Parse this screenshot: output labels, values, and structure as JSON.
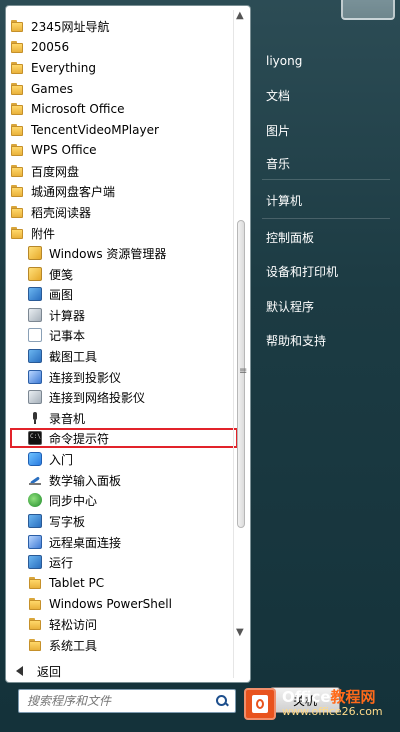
{
  "left_menu": {
    "items": [
      {
        "label": "2345网址导航",
        "icon": "folder-icon"
      },
      {
        "label": "20056",
        "icon": "folder-icon"
      },
      {
        "label": "Everything",
        "icon": "folder-icon"
      },
      {
        "label": "Games",
        "icon": "folder-icon"
      },
      {
        "label": "Microsoft Office",
        "icon": "folder-icon"
      },
      {
        "label": "TencentVideoMPlayer",
        "icon": "folder-icon"
      },
      {
        "label": "WPS Office",
        "icon": "folder-icon"
      },
      {
        "label": "百度网盘",
        "icon": "folder-icon"
      },
      {
        "label": "城通网盘客户端",
        "icon": "folder-icon"
      },
      {
        "label": "稻壳阅读器",
        "icon": "folder-icon"
      },
      {
        "label": "附件",
        "icon": "folder-icon"
      }
    ],
    "accessories": [
      {
        "label": "Windows 资源管理器",
        "icon": "explorer-icon"
      },
      {
        "label": "便笺",
        "icon": "sticky-notes-icon"
      },
      {
        "label": "画图",
        "icon": "paint-icon"
      },
      {
        "label": "计算器",
        "icon": "calculator-icon"
      },
      {
        "label": "记事本",
        "icon": "notepad-icon"
      },
      {
        "label": "截图工具",
        "icon": "snipping-tool-icon"
      },
      {
        "label": "连接到投影仪",
        "icon": "projector-icon"
      },
      {
        "label": "连接到网络投影仪",
        "icon": "network-projector-icon"
      },
      {
        "label": "录音机",
        "icon": "sound-recorder-icon"
      },
      {
        "label": "命令提示符",
        "icon": "command-prompt-icon"
      },
      {
        "label": "入门",
        "icon": "getting-started-icon"
      },
      {
        "label": "数学输入面板",
        "icon": "math-input-panel-icon"
      },
      {
        "label": "同步中心",
        "icon": "sync-center-icon"
      },
      {
        "label": "写字板",
        "icon": "wordpad-icon"
      },
      {
        "label": "远程桌面连接",
        "icon": "remote-desktop-icon"
      },
      {
        "label": "运行",
        "icon": "run-icon"
      },
      {
        "label": "Tablet PC",
        "icon": "folder-icon"
      },
      {
        "label": "Windows PowerShell",
        "icon": "folder-icon"
      },
      {
        "label": "轻松访问",
        "icon": "folder-icon"
      },
      {
        "label": "系统工具",
        "icon": "folder-icon"
      }
    ],
    "back_label": "返回",
    "selected_item": "命令提示符"
  },
  "search": {
    "placeholder": "搜索程序和文件"
  },
  "right_menu": {
    "items": [
      "liyong",
      "文档",
      "图片",
      "音乐",
      "计算机",
      "控制面板",
      "设备和打印机",
      "默认程序",
      "帮助和支持"
    ]
  },
  "shutdown": {
    "label": "关机"
  },
  "watermark": {
    "brand_part1": "Office",
    "brand_part2": "教程网",
    "url": "www.office26.com"
  }
}
